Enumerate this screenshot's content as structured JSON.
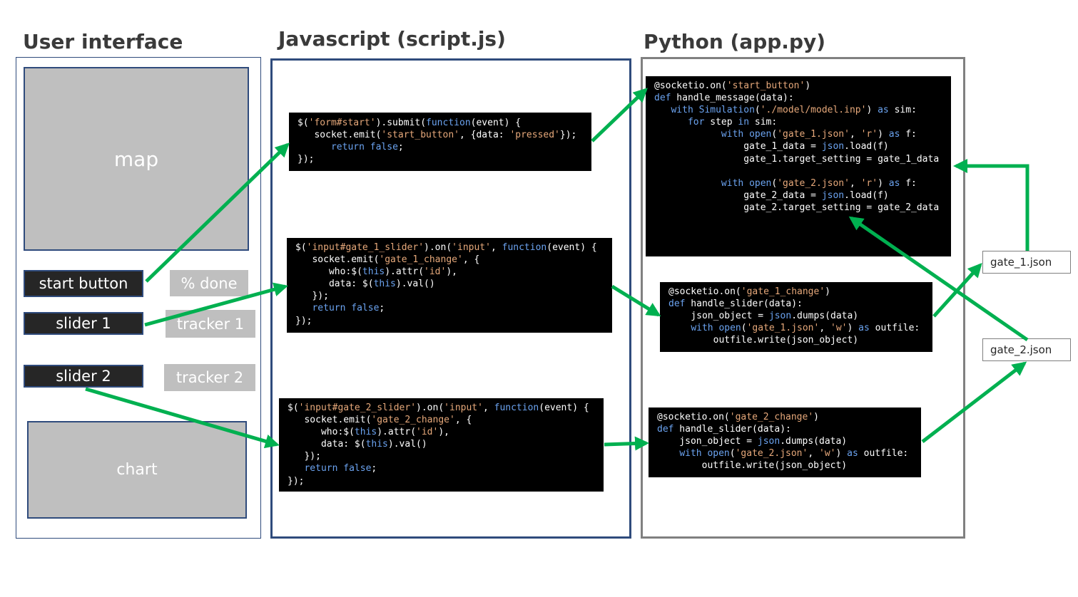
{
  "titles": {
    "ui": "User interface",
    "js": "Javascript (script.js)",
    "py": "Python (app.py)"
  },
  "ui": {
    "map": "map",
    "start_button": "start button",
    "percent_done": "% done",
    "slider_1": "slider 1",
    "tracker_1": "tracker 1",
    "slider_2": "slider 2",
    "tracker_2": "tracker 2",
    "chart": "chart"
  },
  "files": {
    "gate_1": "gate_1.json",
    "gate_2": "gate_2.json"
  },
  "colors": {
    "arrow": "#00b050",
    "ui_border": "#2f4b7c",
    "js_border": "#2f4b7c",
    "py_border": "#808080",
    "code_bg": "#000000",
    "string": "#e6a87a",
    "keyword": "#6ba3f0"
  },
  "code": {
    "js_start": [
      "$('form#start').submit(function(event) {",
      "   socket.emit('start_button', {data: 'pressed'});",
      "      return false;",
      "});"
    ],
    "js_gate1": [
      "$('input#gate_1_slider').on('input', function(event) {",
      "   socket.emit('gate_1_change', {",
      "      who:$(this).attr('id'),",
      "      data: $(this).val()",
      "   });",
      "   return false;",
      "});"
    ],
    "js_gate2": [
      "$('input#gate_2_slider').on('input', function(event) {",
      "   socket.emit('gate_2_change', {",
      "      who:$(this).attr('id'),",
      "      data: $(this).val()",
      "   });",
      "   return false;",
      "});"
    ],
    "py_start": [
      "@socketio.on('start_button')",
      "def handle_message(data):",
      "   with Simulation('./model/model.inp') as sim:",
      "      for step in sim:",
      "            with open('gate_1.json', 'r') as f:",
      "                gate_1_data = json.load(f)",
      "                gate_1.target_setting = gate_1_data",
      "",
      "            with open('gate_2.json', 'r') as f:",
      "                gate_2_data = json.load(f)",
      "                gate_2.target_setting = gate_2_data"
    ],
    "py_gate1": [
      "@socketio.on('gate_1_change')",
      "def handle_slider(data):",
      "    json_object = json.dumps(data)",
      "    with open('gate_1.json', 'w') as outfile:",
      "        outfile.write(json_object)"
    ],
    "py_gate2": [
      "@socketio.on('gate_2_change')",
      "def handle_slider(data):",
      "    json_object = json.dumps(data)",
      "    with open('gate_2.json', 'w') as outfile:",
      "        outfile.write(json_object)"
    ]
  }
}
